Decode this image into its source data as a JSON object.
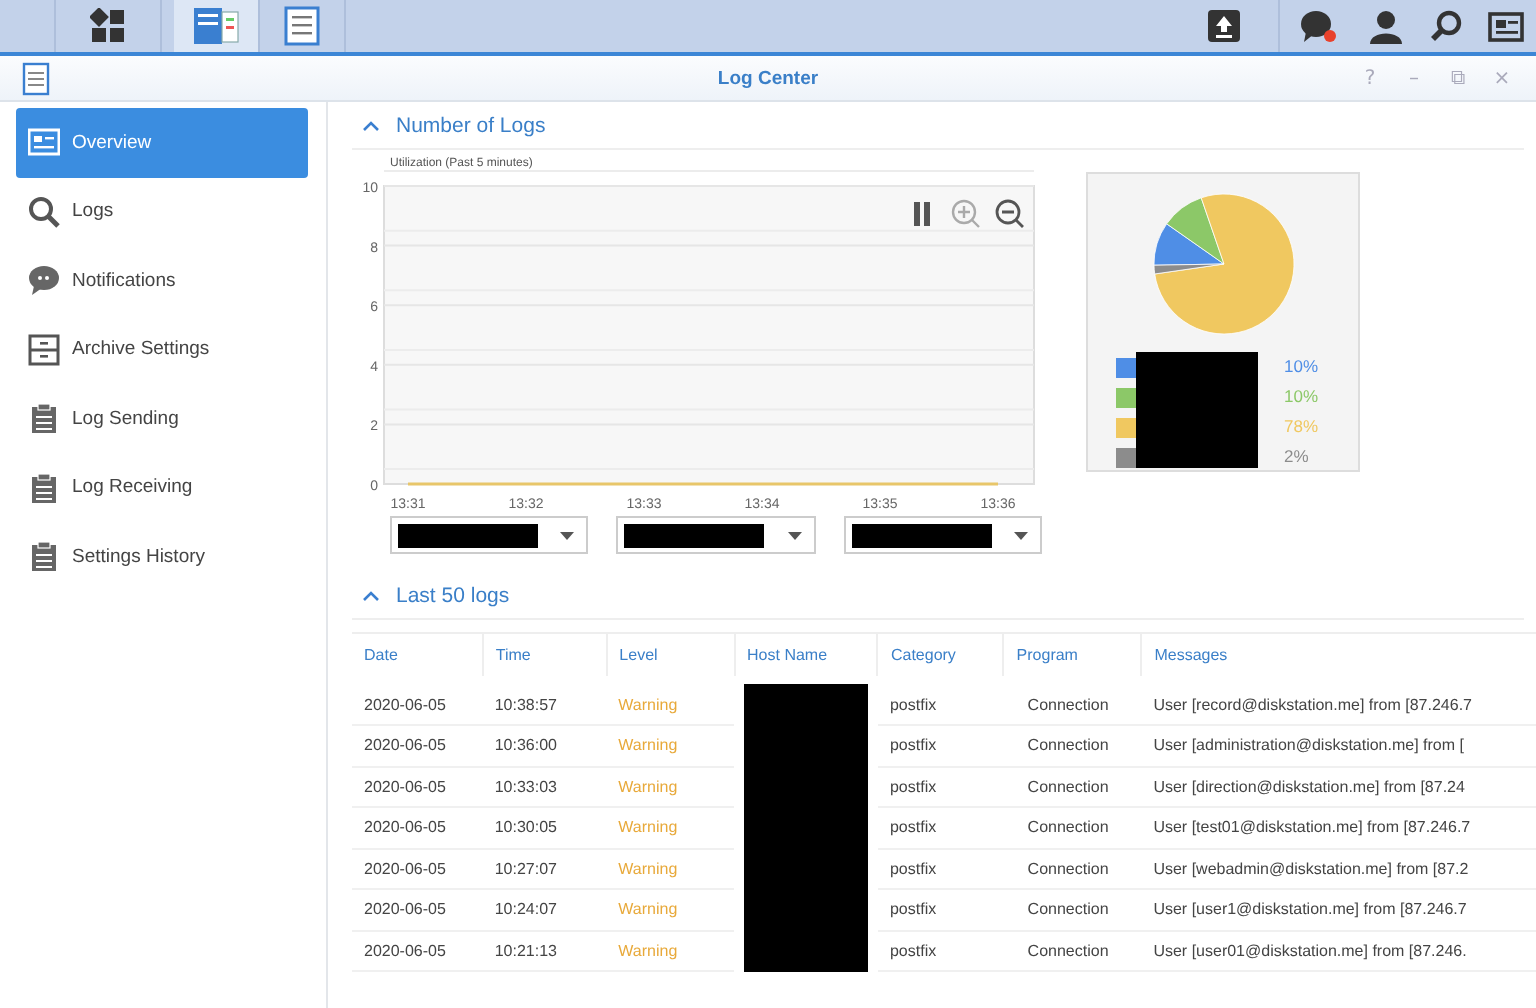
{
  "taskbar": {
    "apps": [
      {
        "kind": "main-menu",
        "selected": false
      },
      {
        "kind": "log-center",
        "selected": true
      },
      {
        "kind": "document",
        "selected": false
      }
    ],
    "tray": [
      {
        "kind": "upload"
      },
      {
        "kind": "chat",
        "badge": true
      },
      {
        "kind": "user"
      },
      {
        "kind": "search"
      },
      {
        "kind": "widgets"
      }
    ]
  },
  "window": {
    "title": "Log Center",
    "controls": [
      "?",
      "–",
      "⧉",
      "×"
    ]
  },
  "sidebar": {
    "items": [
      {
        "label": "Overview",
        "selected": true
      },
      {
        "label": "Logs",
        "selected": false
      },
      {
        "label": "Notifications",
        "selected": false
      },
      {
        "label": "Archive Settings",
        "selected": false
      },
      {
        "label": "Log Sending",
        "selected": false
      },
      {
        "label": "Log Receiving",
        "selected": false
      },
      {
        "label": "Settings History",
        "selected": false
      }
    ]
  },
  "number_of_logs": {
    "heading": "Number of Logs",
    "expanded": true,
    "chart_title": "Utilization (Past 5 minutes)",
    "chart_data": {
      "type": "line",
      "x": [
        "13:31",
        "13:32",
        "13:33",
        "13:34",
        "13:35",
        "13:36"
      ],
      "ylim": [
        0,
        10
      ],
      "yticks": [
        0,
        2,
        4,
        6,
        8,
        10
      ],
      "grid": true,
      "series": [
        {
          "color": "#e8c66a",
          "values": [
            0,
            0,
            0,
            0,
            0,
            0
          ]
        }
      ]
    },
    "pie": {
      "chart_data": {
        "type": "pie",
        "values": [
          10,
          10,
          78,
          2
        ]
      },
      "legend": [
        {
          "color": "#4f8ee6",
          "percent": "10%"
        },
        {
          "color": "#8cc868",
          "percent": "10%"
        },
        {
          "color": "#f0c860",
          "percent": "78%"
        },
        {
          "color": "#8c8c8c",
          "percent": "2%"
        }
      ]
    }
  },
  "last_logs": {
    "heading": "Last 50 logs",
    "expanded": true,
    "columns": [
      "Date",
      "Time",
      "Level",
      "Host Name",
      "Category",
      "Program",
      "Messages"
    ],
    "rows": [
      {
        "date": "2020-06-05",
        "time": "10:38:57",
        "level": "Warning",
        "category": "postfix",
        "program": "Connection",
        "message": "User [record@diskstation.me] from [87.246.7"
      },
      {
        "date": "2020-06-05",
        "time": "10:36:00",
        "level": "Warning",
        "category": "postfix",
        "program": "Connection",
        "message": "User [administration@diskstation.me] from ["
      },
      {
        "date": "2020-06-05",
        "time": "10:33:03",
        "level": "Warning",
        "category": "postfix",
        "program": "Connection",
        "message": "User [direction@diskstation.me] from [87.24"
      },
      {
        "date": "2020-06-05",
        "time": "10:30:05",
        "level": "Warning",
        "category": "postfix",
        "program": "Connection",
        "message": "User [test01@diskstation.me] from [87.246.7"
      },
      {
        "date": "2020-06-05",
        "time": "10:27:07",
        "level": "Warning",
        "category": "postfix",
        "program": "Connection",
        "message": "User [webadmin@diskstation.me] from [87.2"
      },
      {
        "date": "2020-06-05",
        "time": "10:24:07",
        "level": "Warning",
        "category": "postfix",
        "program": "Connection",
        "message": "User [user1@diskstation.me] from [87.246.7"
      },
      {
        "date": "2020-06-05",
        "time": "10:21:13",
        "level": "Warning",
        "category": "postfix",
        "program": "Connection",
        "message": "User [user01@diskstation.me] from [87.246."
      }
    ]
  }
}
